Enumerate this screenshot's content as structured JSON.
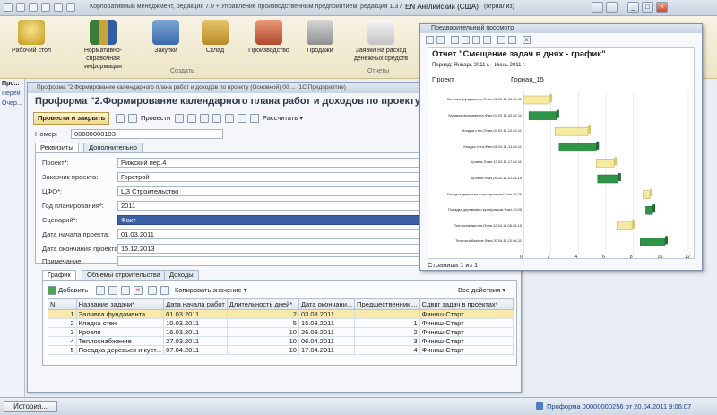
{
  "titlebar": {
    "title": "Корпоративный менеджмент, редакция 7.0 + Управление производственным предприятием, редакция 1.3 /",
    "lang": "EN Английский (США)",
    "lang_extra": "(огрнализ)"
  },
  "ribbon": {
    "items": [
      {
        "label": "Рабочий стол"
      },
      {
        "label": "Нормативно-справочная информация"
      },
      {
        "label": "Закупки"
      },
      {
        "label": "Склад"
      },
      {
        "label": "Производство"
      },
      {
        "label": "Продажи"
      },
      {
        "label": "Заявки на расход денежных средств"
      }
    ],
    "foot": [
      "Создать",
      "Отчеты"
    ]
  },
  "leftnav": {
    "title": "Про...",
    "items": [
      "Перей",
      "Очер..."
    ]
  },
  "form": {
    "window_title": "Проформа \"2.Формирование календарного плана работ и доходов по проекту (Основной) 00 ... (1С:Предприятие)",
    "heading": "Проформа \"2.Формирование календарного плана работ и доходов по проекту (О",
    "toolbar": {
      "post_close": "Провести и закрыть",
      "post": "Провести",
      "calculate": "Рассчитать"
    },
    "number_label": "Номер:",
    "number_value": "00000000193",
    "date_label": "Да",
    "tabs": [
      "Реквизиты",
      "Дополнительно"
    ],
    "fields": [
      {
        "label": "Проект*:",
        "value": "Рижский пер.4"
      },
      {
        "label": "Заказчик проекта:",
        "value": "Горстрой"
      },
      {
        "label": "ЦФО*:",
        "value": "ЦЗ Строительство"
      },
      {
        "label": "Год планирования*:",
        "value": "2011"
      },
      {
        "label": "Сценарий*:",
        "value": "Факт"
      },
      {
        "label": "Дата начала проекта:",
        "value": "01.03.2011"
      },
      {
        "label": "Дата окончания проекта:",
        "value": "15.12.2013"
      },
      {
        "label": "Примечание:",
        "value": ""
      }
    ],
    "lower_tabs": [
      "График",
      "Объемы строительства",
      "Доходы"
    ],
    "grid_toolbar": {
      "add": "Добавить",
      "copy_value": "Копировать значение",
      "all_actions": "Все действия"
    },
    "columns": [
      "N",
      "Название задачи*",
      "Дата начала работ",
      "Длительность дней*",
      "Дата окончани...",
      "Предшественник ...",
      "Сдвиг задач в проектах*"
    ],
    "rows": [
      [
        "1",
        "Заливка фундамента",
        "01.03.2011",
        "2",
        "03.03.2011",
        "",
        "Финиш-Старт"
      ],
      [
        "2",
        "Кладка стен",
        "10.03.2011",
        "5",
        "15.03.2011",
        "1",
        "Финиш-Старт"
      ],
      [
        "3",
        "Кровля",
        "16.03.2011",
        "10",
        "26.03.2011",
        "2",
        "Финиш-Старт"
      ],
      [
        "4",
        "Теплоснабжение",
        "27.03.2011",
        "10",
        "06.04.2011",
        "3",
        "Финиш-Старт"
      ],
      [
        "5",
        "Посадка деревьев и куст...",
        "07.04.2011",
        "10",
        "17.04.2011",
        "4",
        "Финиш-Старт"
      ]
    ]
  },
  "preview": {
    "window_title": "Предварительный просмотр",
    "report_title": "Отчет \"Смещение задач в днях - график\"",
    "period": "Период: Январь 2011 г. - Июнь 2011 г.",
    "project_label": "Проект",
    "project_value": "Горная_15",
    "page_status": "Страница 1 из 1",
    "task_labels": [
      "Заливка фундамента,План,01.02.11,03.02.11",
      "Заливка фундамента,Факт,04.02.11,02.02.11",
      "Кладка стен,План,04.02.11,10.02.11",
      "Кладка стен,Факт,06.02.11,11.04.11",
      "Кровля,План,13.02.11,17.04.11",
      "Кровля,Факт,26.02.11,10.04.15",
      "Посадка деревьев и кустарников,План,26.05",
      "Посадка деревьев и кустарников,Факт,10.05",
      "Теплоснабжение,План,12.04.11,08.06.15",
      "Теплоснабжение,Факт,20.04.11,10.06.11"
    ],
    "ticks": [
      "0",
      "2",
      "4",
      "6",
      "8",
      "10",
      "12"
    ]
  },
  "status": {
    "history": "История...",
    "message": "Проформа 00000000256 от 20.04.2011 9:06:07"
  }
}
